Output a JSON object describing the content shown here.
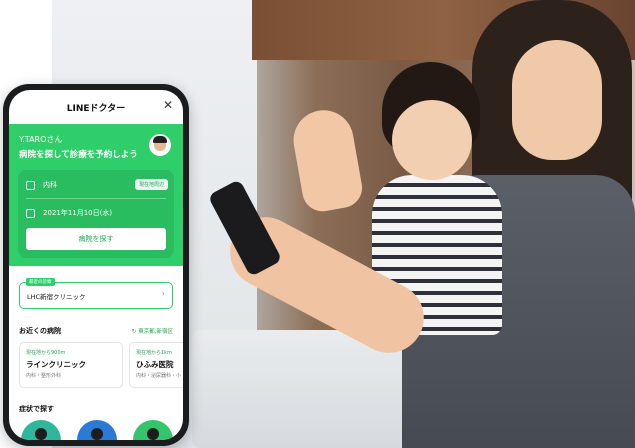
{
  "app": {
    "title": "LINEドクター"
  },
  "greeting": {
    "name": "Y.TAROさん",
    "subtitle": "病院を探して診療を予約しよう"
  },
  "search": {
    "department": "内科",
    "near_chip": "現在地周辺",
    "date": "2021年11月10日(水)",
    "button": "病院を探す"
  },
  "recent": {
    "tag": "最近の診察",
    "clinic": "LHC新宿クリニック"
  },
  "nearby": {
    "title": "お近くの病院",
    "location": "東京都,新宿区",
    "cards": [
      {
        "distance": "現在地から900m",
        "name": "ラインクリニック",
        "departments": "内科・整形外科"
      },
      {
        "distance": "現在地から1km",
        "name": "ひふみ医院",
        "departments": "内科・泌尿器科・小"
      }
    ]
  },
  "symptoms": {
    "title": "症状で探す"
  },
  "colors": {
    "brand_green": "#2fce6a",
    "circle_blue": "#2b7bd6",
    "circle_green": "#34c46c"
  },
  "icons": {
    "close": "close-icon",
    "hospital": "hospital-icon",
    "calendar": "calendar-icon",
    "chevron": "chevron-right-icon",
    "refresh": "refresh-icon"
  }
}
